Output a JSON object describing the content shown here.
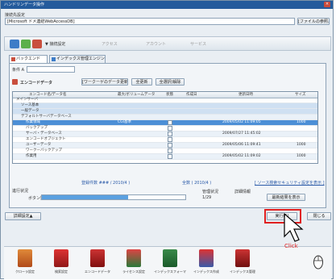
{
  "window": {
    "title": "ハンドリンデータ操作",
    "close": "×"
  },
  "connection": {
    "section_label": "接続先設定",
    "value": "[Microsoft ドメ連結WebAccessDB]",
    "browse_button": "[ファイルの参照...]"
  },
  "toolbar": {
    "dropdown_label": "▼ 接続設定",
    "items": [
      "アクセス",
      "アカウント",
      "サービス"
    ]
  },
  "tabs": [
    {
      "label": "バックエンド"
    },
    {
      "label": "インデックス管理エンジン"
    }
  ],
  "filter": {
    "label": "条件 A",
    "value": ""
  },
  "section": {
    "title": "エンコードデータ",
    "buttons": [
      "[ワークーゲのデータ更新]",
      "全更新",
      "全選択/解除"
    ]
  },
  "grid": {
    "headers": [
      "エンコード名/データ名",
      "最大/ボリュームデータ",
      "状態",
      "作成日",
      "更新日時",
      "サイズ"
    ],
    "rows": [
      {
        "name": "メインサーバ",
        "c2": "",
        "date": "",
        "status": "",
        "extra": ""
      },
      {
        "name": "ソース基本",
        "c2": "",
        "date": "",
        "status": "",
        "extra": ""
      },
      {
        "name": "一般データ",
        "c2": "",
        "date": "",
        "status": "",
        "extra": ""
      },
      {
        "name": "デフォルトサーバデータベース",
        "c2": "",
        "date": "",
        "status": "",
        "extra": ""
      },
      {
        "name": "作業領域",
        "c2": "CGI基準",
        "date": "2009/05/02 11:09:05",
        "status": "",
        "extra": "1000"
      },
      {
        "name": "バックアップ",
        "c2": "",
        "date": "",
        "status": "",
        "extra": ""
      },
      {
        "name": "サーバ・データベース",
        "c2": "",
        "date": "2009/07/27 11:45:02",
        "status": "",
        "extra": ""
      },
      {
        "name": "エンコードオブジェクト",
        "c2": "",
        "date": "",
        "status": "",
        "extra": ""
      },
      {
        "name": "ユーザーデータ",
        "c2": "",
        "date": "2009/05/06 11:09:41",
        "status": "",
        "extra": "1000"
      },
      {
        "name": "ワークーバックアップ",
        "c2": "",
        "date": "",
        "status": "",
        "extra": ""
      },
      {
        "name": "作業用",
        "c2": "",
        "date": "2009/05/02 11:09:02",
        "status": "",
        "extra": "1000"
      }
    ]
  },
  "summary": {
    "text1": "登録件数  ###   /  2010/4  )",
    "text2": "全数  (   2010/4  )",
    "link": "[ ソース検索セキュリティ設定を表示 ]"
  },
  "progress": {
    "label": "進行状況",
    "sublabel": "ボタン数",
    "value": 0.6,
    "count_label": "管理状況",
    "count_value": "1/29",
    "extra_label": "詳細情報",
    "extra_value": "最新結果を表示"
  },
  "bottom": {
    "left_button": "詳細設定▲",
    "ok_button": "実行(S)",
    "cancel_button": "閉じる"
  },
  "apps": [
    {
      "label": "クローラ設定"
    },
    {
      "label": "検索設定"
    },
    {
      "label": "エンコードデータ"
    },
    {
      "label": "ライセンス設定"
    },
    {
      "label": "インデックスフォーマット"
    },
    {
      "label": "インデックス作成"
    },
    {
      "label": "インデックス管理"
    }
  ],
  "annotation": {
    "click_label": "Click"
  },
  "colors": {
    "titlebar": "#245b9c",
    "selection": "#4c8fd6",
    "highlight": "#e02020"
  }
}
